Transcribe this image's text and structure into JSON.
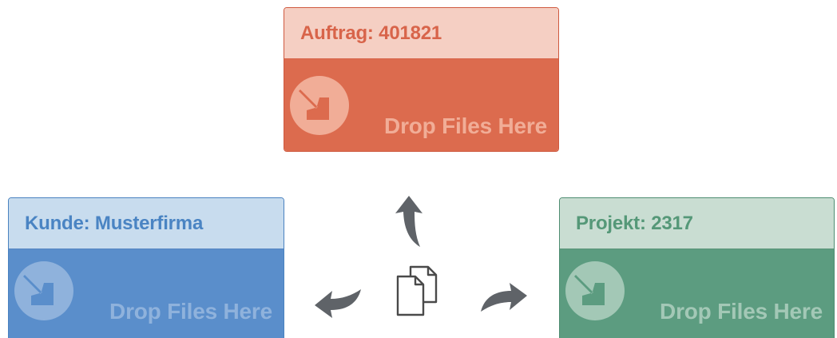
{
  "dropzones": {
    "auftrag": {
      "title": "Auftrag: 401821",
      "drop_label": "Drop Files Here",
      "colors": {
        "header_bg": "#f5cfc3",
        "header_text": "#d8644a",
        "body_bg": "#dc6b4e",
        "label": "#f1ad97"
      }
    },
    "kunde": {
      "title": "Kunde: Musterfirma",
      "drop_label": "Drop Files Here",
      "colors": {
        "header_bg": "#c8dcee",
        "header_text": "#4a84c3",
        "body_bg": "#5a8ecb",
        "label": "#8fb2dc"
      }
    },
    "projekt": {
      "title": "Projekt: 2317",
      "drop_label": "Drop Files Here",
      "colors": {
        "header_bg": "#c9ddd2",
        "header_text": "#559878",
        "body_bg": "#5c9c80",
        "label": "#a3c8b6"
      }
    }
  },
  "center": {
    "files_icon": "documents-icon",
    "arrows": [
      "arrow-up-icon",
      "arrow-left-icon",
      "arrow-right-icon"
    ],
    "arrow_color": "#5f6368"
  }
}
